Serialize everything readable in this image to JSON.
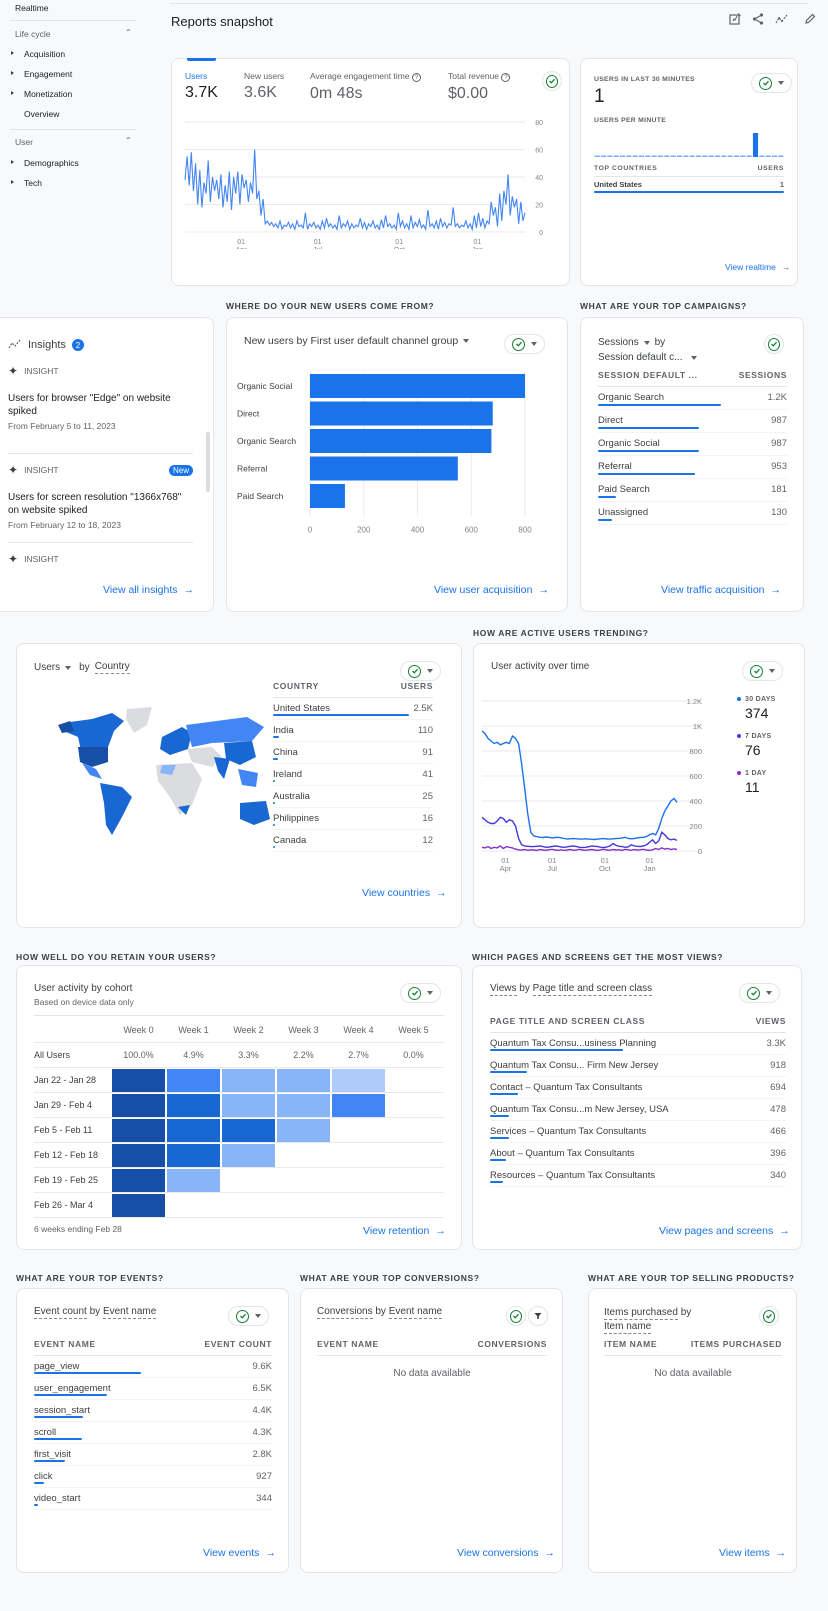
{
  "sidebar": {
    "realtime": "Realtime",
    "lifecycle_label": "Life cycle",
    "lifecycle_items": [
      "Acquisition",
      "Engagement",
      "Monetization",
      "Overview"
    ],
    "user_label": "User",
    "user_items": [
      "Demographics",
      "Tech"
    ]
  },
  "header": {
    "title": "Reports snapshot",
    "icons": [
      "customize-report-icon",
      "share-icon",
      "insights-icon",
      "edit-icon"
    ]
  },
  "overview": {
    "metrics": [
      {
        "label": "Users",
        "value": "3.7K"
      },
      {
        "label": "New users",
        "value": "3.6K"
      },
      {
        "label": "Average engagement time",
        "value": "0m 48s"
      },
      {
        "label": "Total revenue",
        "value": "$0.00"
      }
    ],
    "chart_data": {
      "type": "line",
      "title": "Users",
      "y_ticks": [
        "80",
        "60",
        "40",
        "20",
        "0"
      ],
      "ylim": [
        0,
        80
      ],
      "x_ticks": [
        {
          "day": "01",
          "month": "Apr"
        },
        {
          "day": "01",
          "month": "Jul"
        },
        {
          "day": "01",
          "month": "Oct"
        },
        {
          "day": "01",
          "month": "Jan"
        }
      ],
      "series": [
        {
          "name": "Users",
          "values": [
            38,
            55,
            34,
            58,
            30,
            50,
            20,
            45,
            18,
            36,
            28,
            52,
            22,
            40,
            30,
            38,
            24,
            42,
            18,
            34,
            22,
            44,
            16,
            40,
            28,
            44,
            20,
            42,
            32,
            38,
            22,
            36,
            28,
            60,
            24,
            30,
            12,
            24,
            6,
            8,
            5,
            7,
            4,
            6,
            3,
            8,
            2,
            5,
            4,
            7,
            3,
            6,
            2,
            8,
            4,
            5,
            3,
            14,
            2,
            6,
            4,
            7,
            3,
            5,
            2,
            8,
            3,
            10,
            4,
            6,
            3,
            5,
            2,
            12,
            3,
            6,
            4,
            8,
            2,
            6,
            3,
            5,
            4,
            10,
            3,
            7,
            2,
            6,
            4,
            8,
            3,
            5,
            2,
            9,
            3,
            12,
            4,
            6,
            3,
            5,
            2,
            14,
            4,
            8,
            3,
            6,
            2,
            12,
            3,
            7,
            4,
            9,
            3,
            5,
            2,
            16,
            4,
            6,
            3,
            8,
            2,
            10,
            4,
            7,
            3,
            6,
            5,
            18,
            4,
            6,
            3,
            5,
            4,
            8,
            3,
            6,
            2,
            12,
            3,
            14,
            4,
            10,
            3,
            8,
            6,
            22,
            12,
            18,
            4,
            28,
            8,
            30,
            20,
            42,
            12,
            26,
            18,
            24,
            6,
            22,
            8,
            14
          ]
        }
      ]
    }
  },
  "realtime": {
    "users_label": "USERS IN LAST 30 MINUTES",
    "users_value": "1",
    "per_minute_label": "USERS PER MINUTE",
    "per_minute_values": [
      0,
      0,
      0,
      0,
      0,
      0,
      0,
      0,
      0,
      0,
      0,
      0,
      0,
      0,
      0,
      0,
      0,
      0,
      0,
      0,
      0,
      0,
      0,
      0,
      0,
      1,
      0,
      0,
      0,
      0
    ],
    "countries_header": "TOP COUNTRIES",
    "users_header": "USERS",
    "rows": [
      {
        "label": "United States",
        "value": "1",
        "fraction": 1.0
      }
    ],
    "link": "View realtime"
  },
  "insights": {
    "title": "Insights",
    "count": "2",
    "items": [
      {
        "tag": "INSIGHT",
        "title": "Users for browser \"Edge\" on website spiked",
        "date": "From February 5 to 11, 2023",
        "badge": ""
      },
      {
        "tag": "INSIGHT",
        "title": "Users for screen resolution \"1366x768\" on website spiked",
        "date": "From February 12 to 18, 2023",
        "badge": "New"
      },
      {
        "tag": "INSIGHT",
        "title": "",
        "date": "",
        "badge": ""
      }
    ],
    "link": "View all insights"
  },
  "acquisition": {
    "section": "WHERE DO YOUR NEW USERS COME FROM?",
    "title": "New users by First user default channel group",
    "chart_data": {
      "type": "bar",
      "orientation": "horizontal",
      "categories": [
        "Organic Social",
        "Direct",
        "Organic Search",
        "Referral",
        "Paid Search"
      ],
      "values": [
        800,
        680,
        675,
        550,
        130
      ],
      "x_ticks": [
        "0",
        "200",
        "400",
        "600",
        "800"
      ],
      "xlim": [
        0,
        800
      ],
      "color": "#1a73e8"
    },
    "link": "View user acquisition"
  },
  "campaigns": {
    "section": "WHAT ARE YOUR TOP CAMPAIGNS?",
    "metric": "Sessions",
    "by": "by",
    "dimension": "Session default c...",
    "col1": "SESSION DEFAULT ...",
    "col2": "SESSIONS",
    "rows": [
      {
        "label": "Organic Search",
        "value": "1.2K",
        "fraction": 1.0
      },
      {
        "label": "Direct",
        "value": "987",
        "fraction": 0.82
      },
      {
        "label": "Organic Social",
        "value": "987",
        "fraction": 0.82
      },
      {
        "label": "Referral",
        "value": "953",
        "fraction": 0.79
      },
      {
        "label": "Paid Search",
        "value": "181",
        "fraction": 0.15
      },
      {
        "label": "Unassigned",
        "value": "130",
        "fraction": 0.11
      }
    ],
    "link": "View traffic acquisition"
  },
  "countries": {
    "metric": "Users",
    "by": "by",
    "dimension": "Country",
    "col1": "COUNTRY",
    "col2": "USERS",
    "rows": [
      {
        "label": "United States",
        "value": "2.5K",
        "fraction": 1.0
      },
      {
        "label": "India",
        "value": "110",
        "fraction": 0.044
      },
      {
        "label": "China",
        "value": "91",
        "fraction": 0.036
      },
      {
        "label": "Ireland",
        "value": "41",
        "fraction": 0.016
      },
      {
        "label": "Australia",
        "value": "25",
        "fraction": 0.01
      },
      {
        "label": "Philippines",
        "value": "16",
        "fraction": 0.006
      },
      {
        "label": "Canada",
        "value": "12",
        "fraction": 0.005
      }
    ],
    "link": "View countries"
  },
  "activity": {
    "section": "HOW ARE ACTIVE USERS TRENDING?",
    "title": "User activity over time",
    "chart_data": {
      "type": "line",
      "y_ticks": [
        "1.2K",
        "1K",
        "800",
        "600",
        "400",
        "200",
        "0"
      ],
      "ylim": [
        0,
        1200
      ],
      "x_ticks": [
        {
          "day": "01",
          "month": "Apr"
        },
        {
          "day": "01",
          "month": "Jul"
        },
        {
          "day": "01",
          "month": "Oct"
        },
        {
          "day": "01",
          "month": "Jan"
        }
      ],
      "series": [
        {
          "name": "30 DAYS",
          "color": "#1a73e8",
          "latest": "374",
          "values": [
            960,
            940,
            900,
            880,
            860,
            870,
            850,
            860,
            870,
            860,
            920,
            900,
            860,
            700,
            500,
            300,
            150,
            120,
            115,
            110,
            108,
            112,
            110,
            105,
            108,
            110,
            106,
            100,
            95,
            98,
            100,
            98,
            96,
            95,
            98,
            95,
            94,
            92,
            95,
            98,
            100,
            96,
            95,
            98,
            100,
            102,
            105,
            110,
            100,
            98,
            100,
            105,
            108,
            110,
            115,
            130,
            140,
            130,
            180,
            260,
            320,
            360,
            400,
            420,
            390
          ]
        },
        {
          "name": "7 DAYS",
          "color": "#4737d6",
          "latest": "76",
          "values": [
            270,
            250,
            230,
            220,
            220,
            240,
            270,
            260,
            230,
            250,
            240,
            200,
            100,
            50,
            40,
            38,
            36,
            35,
            38,
            40,
            35,
            30,
            32,
            36,
            40,
            38,
            32,
            30,
            34,
            38,
            40,
            35,
            30,
            28,
            30,
            34,
            40,
            38,
            35,
            30,
            28,
            32,
            40,
            60,
            45,
            38,
            35,
            30,
            34,
            50,
            40,
            38,
            36,
            40,
            50,
            70,
            90,
            60,
            80,
            150,
            130,
            100,
            90,
            95,
            85
          ]
        },
        {
          "name": "1 DAY",
          "color": "#8430ce",
          "latest": "11",
          "values": [
            30,
            25,
            35,
            20,
            30,
            25,
            40,
            20,
            35,
            30,
            25,
            15,
            10,
            8,
            12,
            6,
            10,
            8,
            5,
            12,
            8,
            6,
            10,
            14,
            8,
            6,
            10,
            5,
            8,
            12,
            6,
            9,
            14,
            8,
            6,
            10,
            12,
            8,
            5,
            10,
            14,
            8,
            6,
            12,
            8,
            10,
            5,
            14,
            10,
            6,
            12,
            8,
            10,
            14,
            8,
            6,
            10,
            20,
            12,
            25,
            15,
            20,
            12,
            18,
            11
          ]
        }
      ]
    }
  },
  "retention": {
    "section": "HOW WELL DO YOU RETAIN YOUR USERS?",
    "title": "User activity by cohort",
    "subtitle": "Based on device data only",
    "weeks": [
      "Week 0",
      "Week 1",
      "Week 2",
      "Week 3",
      "Week 4",
      "Week 5"
    ],
    "all_users_label": "All Users",
    "all_users": [
      "100.0%",
      "4.9%",
      "3.3%",
      "2.2%",
      "2.7%",
      "0.0%"
    ],
    "cohorts": [
      {
        "label": "Jan 22 - Jan 28",
        "levels": [
          5,
          3,
          2,
          2,
          1
        ]
      },
      {
        "label": "Jan 29 - Feb 4",
        "levels": [
          5,
          4,
          2,
          2,
          3
        ]
      },
      {
        "label": "Feb 5 - Feb 11",
        "levels": [
          5,
          4,
          4,
          2
        ]
      },
      {
        "label": "Feb 12 - Feb 18",
        "levels": [
          5,
          4,
          2
        ]
      },
      {
        "label": "Feb 19 - Feb 25",
        "levels": [
          5,
          2
        ]
      },
      {
        "label": "Feb 26 - Mar 4",
        "levels": [
          5
        ]
      }
    ],
    "level_colors": [
      "#ffffff",
      "#aecbfa",
      "#8ab4f8",
      "#4285f4",
      "#1967d2",
      "#174ea6"
    ],
    "footer": "6 weeks ending Feb 28",
    "link": "View retention"
  },
  "pages": {
    "section": "WHICH PAGES AND SCREENS GET THE MOST VIEWS?",
    "metric": "Views",
    "by": "by",
    "dimension": "Page title and screen class",
    "col1": "PAGE TITLE AND SCREEN CLASS",
    "col2": "VIEWS",
    "rows": [
      {
        "label": "Quantum Tax Consu...usiness Planning",
        "value": "3.3K",
        "fraction": 1.0
      },
      {
        "label": "Quantum Tax Consu... Firm New Jersey",
        "value": "918",
        "fraction": 0.28
      },
      {
        "label": "Contact – Quantum Tax Consultants",
        "value": "694",
        "fraction": 0.21
      },
      {
        "label": "Quantum Tax Consu...m New Jersey, USA",
        "value": "478",
        "fraction": 0.145
      },
      {
        "label": "Services – Quantum Tax Consultants",
        "value": "466",
        "fraction": 0.14
      },
      {
        "label": "About – Quantum Tax Consultants",
        "value": "396",
        "fraction": 0.12
      },
      {
        "label": "Resources – Quantum Tax Consultants",
        "value": "340",
        "fraction": 0.1
      }
    ],
    "link": "View pages and screens"
  },
  "events": {
    "section": "WHAT ARE YOUR TOP EVENTS?",
    "metric": "Event count",
    "by": "by",
    "dimension": "Event name",
    "col1": "EVENT NAME",
    "col2": "EVENT COUNT",
    "rows": [
      {
        "label": "page_view",
        "value": "9.6K",
        "fraction": 1.0
      },
      {
        "label": "user_engagement",
        "value": "6.5K",
        "fraction": 0.68
      },
      {
        "label": "session_start",
        "value": "4.4K",
        "fraction": 0.46
      },
      {
        "label": "scroll",
        "value": "4.3K",
        "fraction": 0.45
      },
      {
        "label": "first_visit",
        "value": "2.8K",
        "fraction": 0.29
      },
      {
        "label": "click",
        "value": "927",
        "fraction": 0.097
      },
      {
        "label": "video_start",
        "value": "344",
        "fraction": 0.036
      }
    ],
    "link": "View events"
  },
  "conversions": {
    "section": "WHAT ARE YOUR TOP CONVERSIONS?",
    "metric": "Conversions",
    "by": "by",
    "dimension": "Event name",
    "col1": "EVENT NAME",
    "col2": "CONVERSIONS",
    "empty": "No data available",
    "link": "View conversions"
  },
  "products": {
    "section": "WHAT ARE YOUR TOP SELLING PRODUCTS?",
    "metric": "Items purchased",
    "by": "by",
    "dimension": "Item name",
    "col1": "ITEM NAME",
    "col2": "ITEMS PURCHASED",
    "empty": "No data available",
    "link": "View items"
  }
}
